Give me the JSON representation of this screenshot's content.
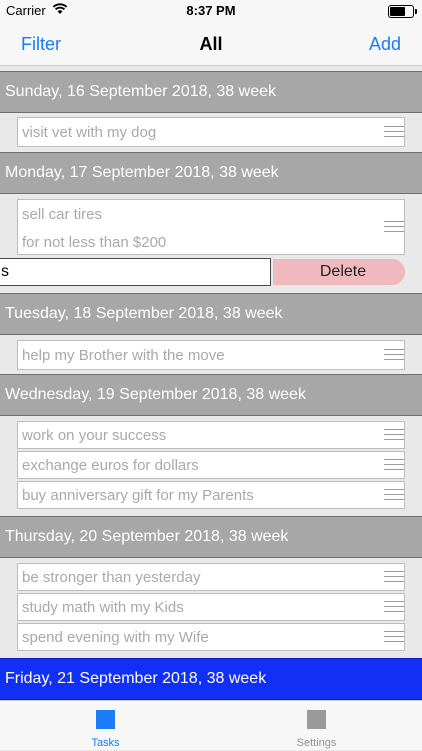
{
  "status_bar": {
    "carrier": "Carrier",
    "time": "8:37 PM"
  },
  "nav": {
    "filter_label": "Filter",
    "title": "All",
    "add_label": "Add"
  },
  "sections": [
    {
      "title": "Sunday, 16 September 2018, 38 week",
      "tasks": [
        {
          "lines": [
            "visit vet with my dog"
          ]
        }
      ]
    },
    {
      "title": "Monday, 17 September 2018, 38 week",
      "tasks": [
        {
          "lines": [
            "sell car tires",
            "for not less than $200"
          ]
        }
      ],
      "editing_row": {
        "value": "s",
        "delete_label": "Delete"
      }
    },
    {
      "title": "Tuesday, 18 September 2018, 38 week",
      "tasks": [
        {
          "lines": [
            "help my Brother with the move"
          ]
        }
      ]
    },
    {
      "title": "Wednesday, 19 September 2018, 38 week",
      "tasks": [
        {
          "lines": [
            "work on your success"
          ]
        },
        {
          "lines": [
            "exchange euros for dollars"
          ]
        },
        {
          "lines": [
            "buy anniversary gift for my Parents"
          ]
        }
      ]
    },
    {
      "title": "Thursday, 20 September 2018, 38 week",
      "tasks": [
        {
          "lines": [
            "be stronger than yesterday"
          ]
        },
        {
          "lines": [
            "study math with my Kids"
          ]
        },
        {
          "lines": [
            "spend evening with my Wife"
          ]
        }
      ]
    },
    {
      "title": "Friday, 21 September 2018, 38 week",
      "tasks": []
    }
  ],
  "tabs": [
    {
      "label": "Tasks",
      "icon": "square-icon",
      "color": "#1a7cf7",
      "selected": true
    },
    {
      "label": "Settings",
      "icon": "square-icon",
      "color": "#929292",
      "selected": false
    }
  ],
  "colors": {
    "accent": "#1a7cf7",
    "section_header": "#a7a7a7",
    "today_header": "#1230f5",
    "delete": "#f0b9bd"
  }
}
